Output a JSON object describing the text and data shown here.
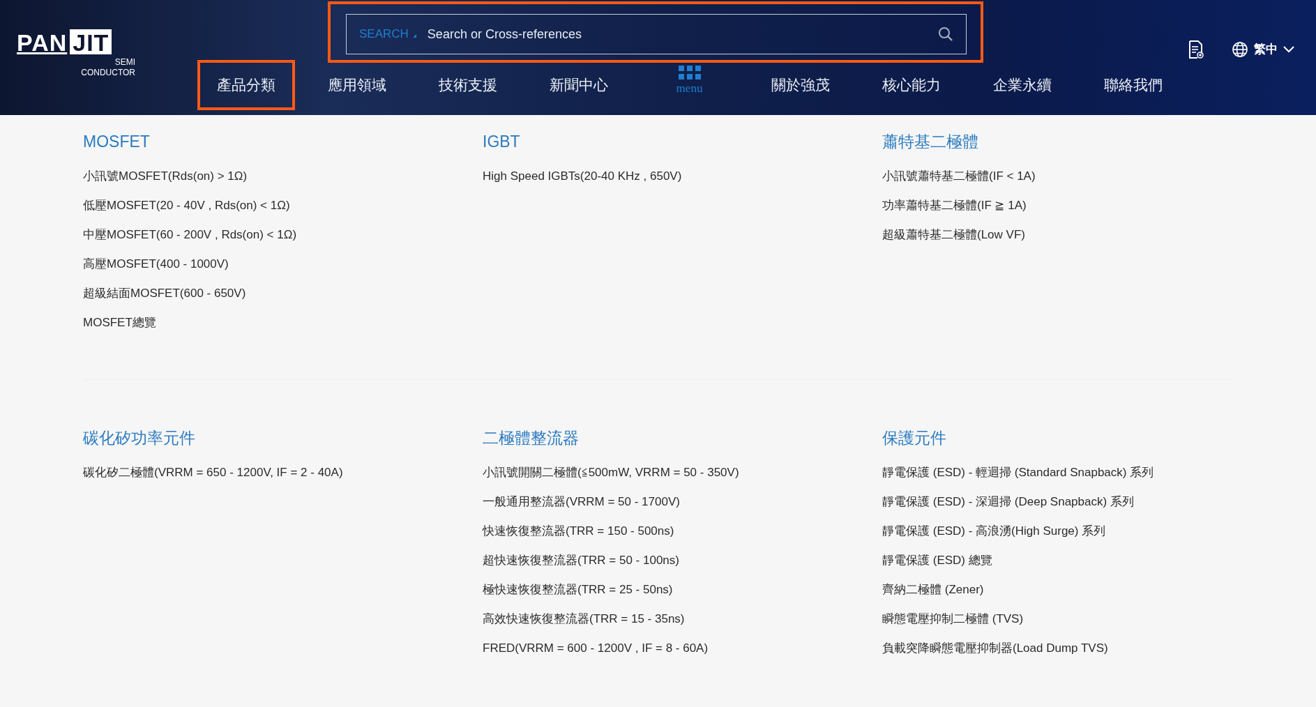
{
  "header": {
    "logo": {
      "brand_left": "PAN",
      "brand_right": "JIT",
      "tagline_1": "SEMI",
      "tagline_2": "CONDUCTOR"
    },
    "search": {
      "scope": "SEARCH",
      "placeholder": "Search or Cross-references",
      "highlighted": true
    },
    "nav": [
      {
        "label": "產品分類",
        "kind": "link",
        "selected": true
      },
      {
        "label": "應用領域",
        "kind": "link",
        "selected": false
      },
      {
        "label": "技術支援",
        "kind": "link",
        "selected": false
      },
      {
        "label": "新聞中心",
        "kind": "link",
        "selected": false
      },
      {
        "label": "menu",
        "kind": "menu",
        "selected": false
      },
      {
        "label": "關於強茂",
        "kind": "link",
        "selected": false
      },
      {
        "label": "核心能力",
        "kind": "link",
        "selected": false
      },
      {
        "label": "企業永續",
        "kind": "link",
        "selected": false
      },
      {
        "label": "聯絡我們",
        "kind": "link",
        "selected": false
      }
    ],
    "language": "繁中"
  },
  "category_rows": [
    [
      {
        "title": "MOSFET",
        "items": [
          "小訊號MOSFET(Rds(on) > 1Ω)",
          "低壓MOSFET(20 - 40V , Rds(on) < 1Ω)",
          "中壓MOSFET(60 - 200V , Rds(on) < 1Ω)",
          "高壓MOSFET(400 - 1000V)",
          "超級結面MOSFET(600 - 650V)",
          "MOSFET總覽"
        ]
      },
      {
        "title": "IGBT",
        "items": [
          "High Speed IGBTs(20-40 KHz , 650V)"
        ]
      },
      {
        "title": "蕭特基二極體",
        "items": [
          "小訊號蕭特基二極體(IF < 1A)",
          "功率蕭特基二極體(IF ≧ 1A)",
          "超級蕭特基二極體(Low VF)"
        ]
      }
    ],
    [
      {
        "title": "碳化矽功率元件",
        "items": [
          "碳化矽二極體(VRRM = 650 - 1200V, IF = 2 - 40A)"
        ]
      },
      {
        "title": "二極體整流器",
        "items": [
          "小訊號開關二極體(≦500mW, VRRM = 50 - 350V)",
          "一般通用整流器(VRRM = 50 - 1700V)",
          "快速恢復整流器(TRR = 150 - 500ns)",
          "超快速恢復整流器(TRR = 50 - 100ns)",
          "極快速恢復整流器(TRR = 25 - 50ns)",
          "高效快速恢復整流器(TRR = 15 - 35ns)",
          "FRED(VRRM = 600 - 1200V , IF = 8 - 60A)"
        ]
      },
      {
        "title": "保護元件",
        "items": [
          "靜電保護 (ESD) - 輕迴掃 (Standard Snapback) 系列",
          "靜電保護 (ESD) - 深迴掃 (Deep Snapback) 系列",
          "靜電保護 (ESD) - 高浪湧(High Surge) 系列",
          "靜電保護 (ESD) 總覽",
          "齊納二極體 (Zener)",
          "瞬態電壓抑制二極體 (TVS)",
          "負載突降瞬態電壓抑制器(Load Dump TVS)"
        ]
      }
    ]
  ]
}
